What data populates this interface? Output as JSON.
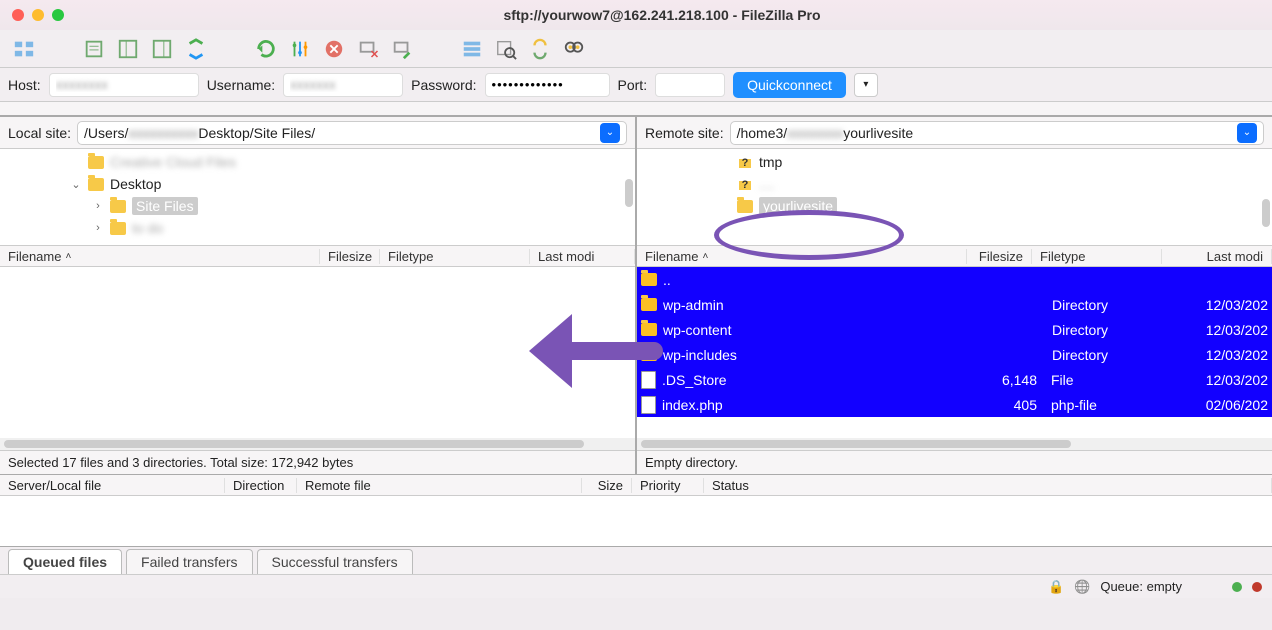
{
  "window_title": "sftp://yourwow7@162.241.218.100 - FileZilla Pro",
  "connect": {
    "host_label": "Host:",
    "user_label": "Username:",
    "pass_label": "Password:",
    "pass_value": "•••••••••••••",
    "port_label": "Port:",
    "quickconnect": "Quickconnect"
  },
  "local": {
    "label": "Local site:",
    "path_prefix": "/Users/",
    "path_suffix": "Desktop/Site Files/",
    "tree": [
      {
        "indent": 70,
        "arrow": "",
        "icon": "folder",
        "label": "Creative Cloud Files",
        "blur": true
      },
      {
        "indent": 70,
        "arrow": "⌄",
        "icon": "folder",
        "label": "Desktop"
      },
      {
        "indent": 92,
        "arrow": "›",
        "icon": "folder",
        "label": "Site Files",
        "sel": true
      },
      {
        "indent": 92,
        "arrow": "›",
        "icon": "folder",
        "label": "to do",
        "blur": true
      }
    ],
    "cols": {
      "name": "Filename",
      "size": "Filesize",
      "type": "Filetype",
      "mod": "Last modi"
    },
    "status": "Selected 17 files and 3 directories. Total size: 172,942 bytes"
  },
  "remote": {
    "label": "Remote site:",
    "path_prefix": "/home3/",
    "path_suffix": "yourlivesite",
    "tree": [
      {
        "icon": "q",
        "label": "tmp"
      },
      {
        "icon": "q",
        "label": "....",
        "blur": true
      },
      {
        "icon": "folder",
        "label": "yourlivesite",
        "sel": true
      }
    ],
    "cols": {
      "name": "Filename",
      "size": "Filesize",
      "type": "Filetype",
      "mod": "Last modi"
    },
    "files": [
      {
        "icon": "folder",
        "name": "..",
        "size": "",
        "type": "",
        "mod": ""
      },
      {
        "icon": "folder",
        "name": "wp-admin",
        "size": "",
        "type": "Directory",
        "mod": "12/03/202"
      },
      {
        "icon": "folder",
        "name": "wp-content",
        "size": "",
        "type": "Directory",
        "mod": "12/03/202"
      },
      {
        "icon": "folder",
        "name": "wp-includes",
        "size": "",
        "type": "Directory",
        "mod": "12/03/202"
      },
      {
        "icon": "file",
        "name": ".DS_Store",
        "size": "6,148",
        "type": "File",
        "mod": "12/03/202"
      },
      {
        "icon": "file",
        "name": "index.php",
        "size": "405",
        "type": "php-file",
        "mod": "02/06/202"
      }
    ],
    "status": "Empty directory."
  },
  "queue_cols": {
    "server": "Server/Local file",
    "dir": "Direction",
    "remote": "Remote file",
    "size": "Size",
    "priority": "Priority",
    "status": "Status"
  },
  "tabs": {
    "queued": "Queued files",
    "failed": "Failed transfers",
    "success": "Successful transfers"
  },
  "footer": {
    "queue": "Queue: empty"
  }
}
